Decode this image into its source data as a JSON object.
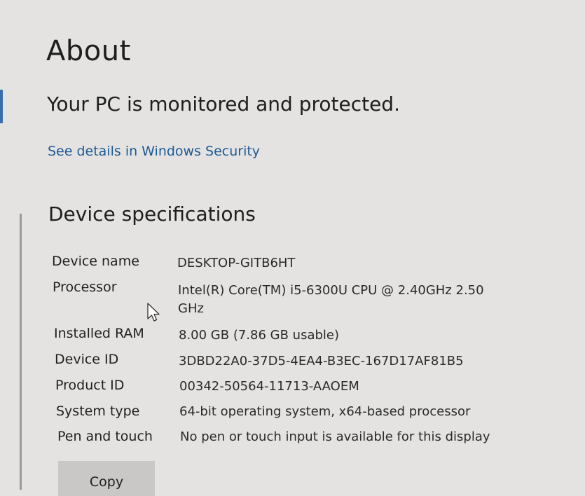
{
  "page": {
    "title": "About",
    "protection_status": "Your PC is monitored and protected.",
    "security_link": "See details in Windows Security"
  },
  "device_specifications": {
    "heading": "Device specifications",
    "rows": [
      {
        "label": "Device name",
        "value": "DESKTOP-GITB6HT"
      },
      {
        "label": "Processor",
        "value": "Intel(R) Core(TM) i5-6300U CPU @ 2.40GHz   2.50",
        "value_cont": "GHz"
      },
      {
        "label": "Installed RAM",
        "value": "8.00 GB (7.86 GB usable)"
      },
      {
        "label": "Device ID",
        "value": "3DBD22A0-37D5-4EA4-B3EC-167D17AF81B5"
      },
      {
        "label": "Product ID",
        "value": "00342-50564-11713-AAOEM"
      },
      {
        "label": "System type",
        "value": "64-bit operating system, x64-based processor"
      },
      {
        "label": "Pen and touch",
        "value": "No pen or touch input is available for this display"
      }
    ],
    "copy_button": "Copy"
  },
  "icons": {
    "cursor": "mouse-pointer-icon"
  },
  "colors": {
    "background": "#e4e3e1",
    "link": "#1e5a96",
    "accent": "#3a6ea8",
    "button": "#c9c8c6"
  }
}
